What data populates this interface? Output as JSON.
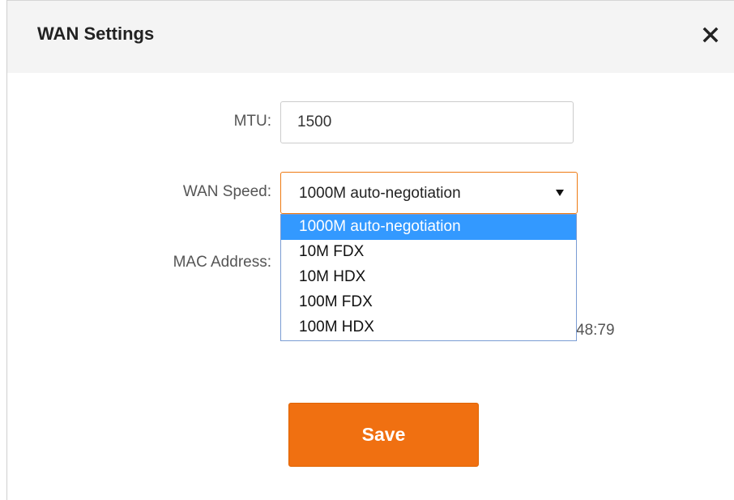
{
  "dialog": {
    "title": "WAN Settings",
    "close_icon": "close-icon"
  },
  "form": {
    "mtu_label": "MTU:",
    "mtu_value": "1500",
    "wan_speed_label": "WAN Speed:",
    "wan_speed_selected": "1000M auto-negotiation",
    "wan_speed_options": [
      "1000M auto-negotiation",
      "10M FDX",
      "10M HDX",
      "100M FDX",
      "100M HDX"
    ],
    "mac_label": "MAC Address:",
    "mac_partial_visible": "48:79",
    "save_label": "Save"
  },
  "colors": {
    "accent": "#f07011",
    "select_border": "#ee7a12",
    "option_highlight": "#3399ff"
  }
}
